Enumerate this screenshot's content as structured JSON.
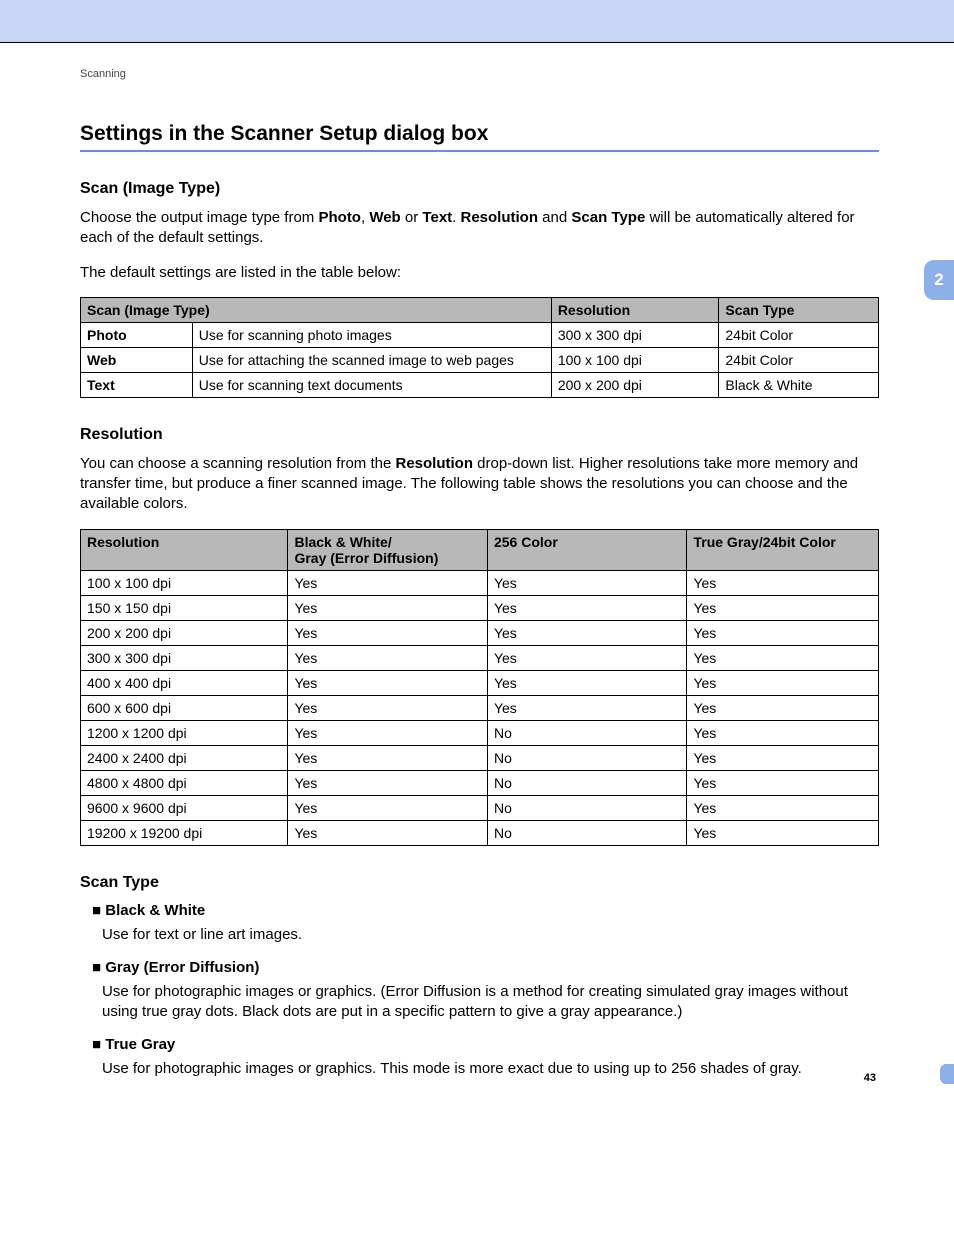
{
  "breadcrumb": "Scanning",
  "chapter_tab": "2",
  "page_number": "43",
  "main_heading": "Settings in the Scanner Setup dialog box",
  "section_scan_image_type": {
    "heading": "Scan (Image Type)",
    "para1_parts": {
      "p1": "Choose the output image type from ",
      "b1": "Photo",
      "s1": ", ",
      "b2": "Web",
      "s2": " or ",
      "b3": "Text",
      "s3": ". ",
      "b4": "Resolution",
      "s4": " and ",
      "b5": "Scan Type",
      "s5": " will be automatically altered for each of the default settings."
    },
    "para2": "The default settings are listed in the table below:",
    "table": {
      "headers": {
        "c1": "Scan (Image Type)",
        "c2": "Resolution",
        "c3": "Scan Type"
      },
      "rows": [
        {
          "type": "Photo",
          "desc": "Use for scanning photo images",
          "res": "300 x 300 dpi",
          "stype": "24bit Color"
        },
        {
          "type": "Web",
          "desc": "Use for attaching the scanned image to web pages",
          "res": "100 x 100 dpi",
          "stype": "24bit Color"
        },
        {
          "type": "Text",
          "desc": "Use for scanning text documents",
          "res": "200 x 200 dpi",
          "stype": "Black & White"
        }
      ]
    }
  },
  "section_resolution": {
    "heading": "Resolution",
    "para1_parts": {
      "p1": "You can choose a scanning resolution from the ",
      "b1": "Resolution",
      "p2": " drop-down list. Higher resolutions take more memory and transfer time, but produce a finer scanned image. The following table shows the resolutions you can choose and the available colors."
    },
    "table": {
      "headers": {
        "c1": "Resolution",
        "c2": "Black & White/\nGray (Error Diffusion)",
        "c3": "256 Color",
        "c4": "True Gray/24bit Color"
      },
      "rows": [
        {
          "res": "100 x 100 dpi",
          "bw": "Yes",
          "c256": "Yes",
          "tg": "Yes"
        },
        {
          "res": "150 x 150 dpi",
          "bw": "Yes",
          "c256": "Yes",
          "tg": "Yes"
        },
        {
          "res": "200 x 200 dpi",
          "bw": "Yes",
          "c256": "Yes",
          "tg": "Yes"
        },
        {
          "res": "300 x 300 dpi",
          "bw": "Yes",
          "c256": "Yes",
          "tg": "Yes"
        },
        {
          "res": "400 x 400 dpi",
          "bw": "Yes",
          "c256": "Yes",
          "tg": "Yes"
        },
        {
          "res": "600 x 600 dpi",
          "bw": "Yes",
          "c256": "Yes",
          "tg": "Yes"
        },
        {
          "res": "1200 x 1200 dpi",
          "bw": "Yes",
          "c256": "No",
          "tg": "Yes"
        },
        {
          "res": "2400 x 2400 dpi",
          "bw": "Yes",
          "c256": "No",
          "tg": "Yes"
        },
        {
          "res": "4800 x 4800 dpi",
          "bw": "Yes",
          "c256": "No",
          "tg": "Yes"
        },
        {
          "res": "9600 x 9600 dpi",
          "bw": "Yes",
          "c256": "No",
          "tg": "Yes"
        },
        {
          "res": "19200 x 19200 dpi",
          "bw": "Yes",
          "c256": "No",
          "tg": "Yes"
        }
      ]
    }
  },
  "section_scan_type": {
    "heading": "Scan Type",
    "items": [
      {
        "label": "Black & White",
        "desc": "Use for text or line art images."
      },
      {
        "label": "Gray (Error Diffusion)",
        "desc": "Use for photographic images or graphics. (Error Diffusion is a method for creating simulated gray images without using true gray dots. Black dots are put in a specific pattern to give a gray appearance.)"
      },
      {
        "label": "True Gray",
        "desc": "Use for photographic images or graphics. This mode is more exact due to using up to 256 shades of gray."
      }
    ]
  }
}
